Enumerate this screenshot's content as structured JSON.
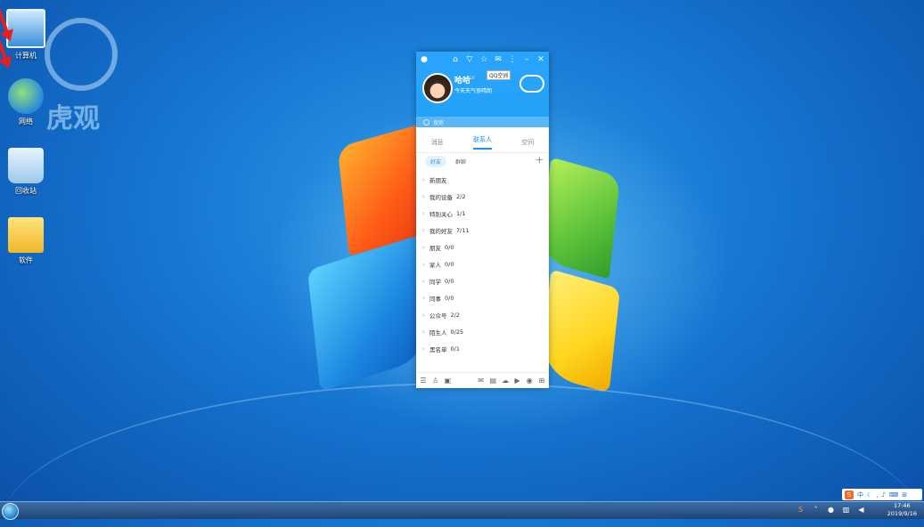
{
  "desktop": {
    "icons": [
      {
        "label": "计算机"
      },
      {
        "label": "网络"
      },
      {
        "label": "回收站"
      },
      {
        "label": "软件"
      }
    ],
    "watermark_text": "虎观"
  },
  "qq": {
    "topbar_icons": [
      "qq-logo-icon",
      "lock-icon",
      "shirt-icon",
      "star-icon",
      "mail-icon",
      "more-icon",
      "minimize-icon",
      "close-icon"
    ],
    "tooltip": "QQ空间",
    "nickname": "哈哈",
    "status_badge": "LV",
    "signature": "今天天气很晴朗",
    "search_placeholder": "搜索",
    "tabs": [
      {
        "label": "消息",
        "active": false
      },
      {
        "label": "联系人",
        "active": true
      },
      {
        "label": "空间",
        "active": false
      }
    ],
    "subtabs": [
      {
        "label": "好友",
        "active": true
      },
      {
        "label": "群聊",
        "active": false
      }
    ],
    "plus_label": "+",
    "groups": [
      {
        "name": "新朋友",
        "count": ""
      },
      {
        "name": "我的设备",
        "count": "2/2"
      },
      {
        "name": "特别关心",
        "count": "1/1"
      },
      {
        "name": "我的好友",
        "count": "7/11"
      },
      {
        "name": "朋友",
        "count": "0/0"
      },
      {
        "name": "家人",
        "count": "0/0"
      },
      {
        "name": "同学",
        "count": "0/0"
      },
      {
        "name": "同事",
        "count": "0/0"
      },
      {
        "name": "公众号",
        "count": "2/2"
      },
      {
        "name": "陌生人",
        "count": "0/25"
      },
      {
        "name": "黑名单",
        "count": "0/1"
      }
    ],
    "bottom_icons": [
      "menu-icon",
      "add-friend-icon",
      "apps-icon",
      "mail-icon",
      "screen-icon",
      "cloud-icon",
      "play-icon",
      "qzone-icon",
      "grid-icon"
    ]
  },
  "taskbar": {
    "ime_text": "中",
    "time": "17:46",
    "date": "2019/9/16"
  }
}
